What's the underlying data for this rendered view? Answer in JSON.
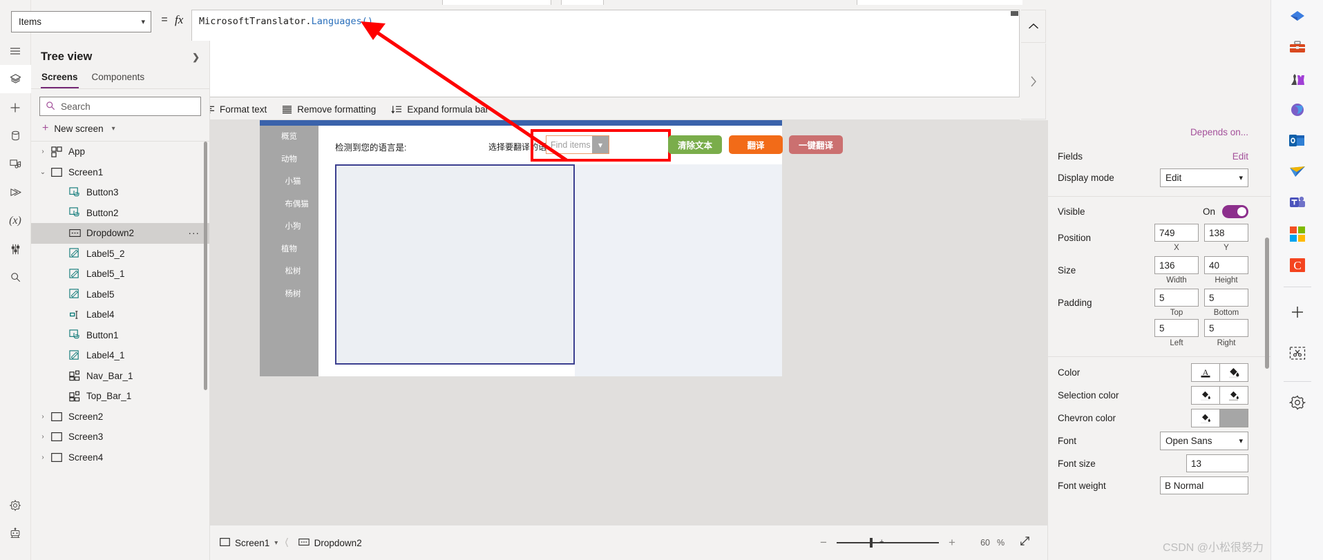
{
  "formula_bar": {
    "property_selector": "Items",
    "equals": "=",
    "fx": "fx",
    "formula_prefix": "MicrosoftTranslator.",
    "formula_fn": "Languages()",
    "collapse_icon": "chevron-up-icon",
    "expand_icon": "chevron-right-icon"
  },
  "format_toolbar": {
    "items": [
      {
        "label": "Format text",
        "icon": "format-text-icon"
      },
      {
        "label": "Remove formatting",
        "icon": "remove-formatting-icon"
      },
      {
        "label": "Expand formula bar",
        "icon": "expand-formula-icon"
      }
    ]
  },
  "left_rail": {
    "items": [
      {
        "name": "menu",
        "glyph": "hamburger-icon",
        "active": false
      },
      {
        "name": "tree-view",
        "glyph": "layers-icon",
        "active": true
      },
      {
        "name": "insert",
        "glyph": "plus-icon",
        "active": false
      },
      {
        "name": "data",
        "glyph": "database-icon",
        "active": false
      },
      {
        "name": "media",
        "glyph": "media-icon",
        "active": false
      },
      {
        "name": "power-automate",
        "glyph": "flow-icon",
        "active": false
      },
      {
        "name": "variables",
        "glyph": "variables-icon",
        "active": false
      },
      {
        "name": "app-checker",
        "glyph": "tools-icon",
        "active": false
      },
      {
        "name": "search",
        "glyph": "search-icon",
        "active": false
      }
    ],
    "bottom_items": [
      {
        "name": "settings",
        "glyph": "gear-icon"
      },
      {
        "name": "copilot",
        "glyph": "robot-icon"
      }
    ]
  },
  "tree_view": {
    "title": "Tree view",
    "tabs": [
      {
        "label": "Screens",
        "active": true
      },
      {
        "label": "Components",
        "active": false
      }
    ],
    "search_placeholder": "Search",
    "new_screen_label": "New screen",
    "items": [
      {
        "label": "App",
        "icon": "app-icon",
        "indent": 0,
        "twisty": "›",
        "selected": false
      },
      {
        "label": "Screen1",
        "icon": "screen-icon",
        "indent": 0,
        "twisty": "⌄",
        "selected": false
      },
      {
        "label": "Button3",
        "icon": "button-icon",
        "indent": 1,
        "twisty": "",
        "selected": false
      },
      {
        "label": "Button2",
        "icon": "button-icon",
        "indent": 1,
        "twisty": "",
        "selected": false
      },
      {
        "label": "Dropdown2",
        "icon": "dropdown-icon",
        "indent": 1,
        "twisty": "",
        "selected": true,
        "ellipsis": "…"
      },
      {
        "label": "Label5_2",
        "icon": "label-icon",
        "indent": 1,
        "twisty": "",
        "selected": false
      },
      {
        "label": "Label5_1",
        "icon": "label-icon",
        "indent": 1,
        "twisty": "",
        "selected": false
      },
      {
        "label": "Label5",
        "icon": "label-icon",
        "indent": 1,
        "twisty": "",
        "selected": false
      },
      {
        "label": "Label4",
        "icon": "textinput-icon",
        "indent": 1,
        "twisty": "",
        "selected": false
      },
      {
        "label": "Button1",
        "icon": "button-icon",
        "indent": 1,
        "twisty": "",
        "selected": false
      },
      {
        "label": "Label4_1",
        "icon": "label-icon",
        "indent": 1,
        "twisty": "",
        "selected": false
      },
      {
        "label": "Nav_Bar_1",
        "icon": "component-icon",
        "indent": 1,
        "twisty": "",
        "selected": false
      },
      {
        "label": "Top_Bar_1",
        "icon": "component-icon",
        "indent": 1,
        "twisty": "",
        "selected": false
      },
      {
        "label": "Screen2",
        "icon": "screen-icon",
        "indent": 0,
        "twisty": "›",
        "selected": false
      },
      {
        "label": "Screen3",
        "icon": "screen-icon",
        "indent": 0,
        "twisty": "›",
        "selected": false
      },
      {
        "label": "Screen4",
        "icon": "screen-icon",
        "indent": 0,
        "twisty": "›",
        "selected": false
      }
    ]
  },
  "canvas_app": {
    "side_nav": [
      {
        "label": "概览",
        "level": 0
      },
      {
        "label": "动物",
        "level": 0
      },
      {
        "label": "小猫",
        "level": 1
      },
      {
        "label": "布偶猫",
        "level": 2
      },
      {
        "label": "小狗",
        "level": 1
      },
      {
        "label": "植物",
        "level": 0
      },
      {
        "label": "松树",
        "level": 1
      },
      {
        "label": "杨树",
        "level": 1
      }
    ],
    "detected_language_label": "检测到您的语言是:",
    "select_language_label": "选择要翻译的语言:",
    "dropdown_placeholder": "Find items",
    "buttons": [
      {
        "label": "清除文本",
        "color": "#7aad4b"
      },
      {
        "label": "翻译",
        "color": "#f26b18"
      },
      {
        "label": "一键翻译",
        "color": "#cb7070"
      }
    ]
  },
  "status_bar": {
    "screen_crumb": "Screen1",
    "control_crumb": "Dropdown2",
    "zoom_percent": "60",
    "percent_sign": "%",
    "minus_icon": "minus-icon",
    "plus_icon": "plus-icon",
    "fit_icon": "fit-screen-icon"
  },
  "properties": {
    "depends_on": "Depends on...",
    "fields_label": "Fields",
    "fields_action": "Edit",
    "display_mode_label": "Display mode",
    "display_mode_value": "Edit",
    "visible_label": "Visible",
    "visible_state": "On",
    "position_label": "Position",
    "position_x": "749",
    "position_y": "138",
    "position_x_cap": "X",
    "position_y_cap": "Y",
    "size_label": "Size",
    "size_width": "136",
    "size_height": "40",
    "size_width_cap": "Width",
    "size_height_cap": "Height",
    "padding_label": "Padding",
    "padding_top": "5",
    "padding_bottom": "5",
    "padding_left": "5",
    "padding_right": "5",
    "padding_top_cap": "Top",
    "padding_bottom_cap": "Bottom",
    "padding_left_cap": "Left",
    "padding_right_cap": "Right",
    "color_label": "Color",
    "selection_color_label": "Selection color",
    "chevron_color_label": "Chevron color",
    "chevron_color_swatch": "#a6a6a6",
    "font_label": "Font",
    "font_value": "Open Sans",
    "font_size_label": "Font size",
    "font_size_value": "13",
    "font_weight_label": "Font weight",
    "font_weight_value": "B  Normal"
  },
  "browser_rail": {
    "items": [
      {
        "name": "shopping-tag-icon"
      },
      {
        "name": "toolbox-icon"
      },
      {
        "name": "games-icon"
      },
      {
        "name": "microsoft-365-icon"
      },
      {
        "name": "outlook-icon"
      },
      {
        "name": "send-icon"
      },
      {
        "name": "teams-icon"
      },
      {
        "name": "microsoft-logo-icon"
      },
      {
        "name": "c-app-icon"
      }
    ],
    "bottom_items": [
      {
        "name": "add-icon"
      },
      {
        "name": "screenshot-icon"
      },
      {
        "name": "settings-gear-icon"
      }
    ]
  },
  "watermark": "CSDN @小松很努力"
}
